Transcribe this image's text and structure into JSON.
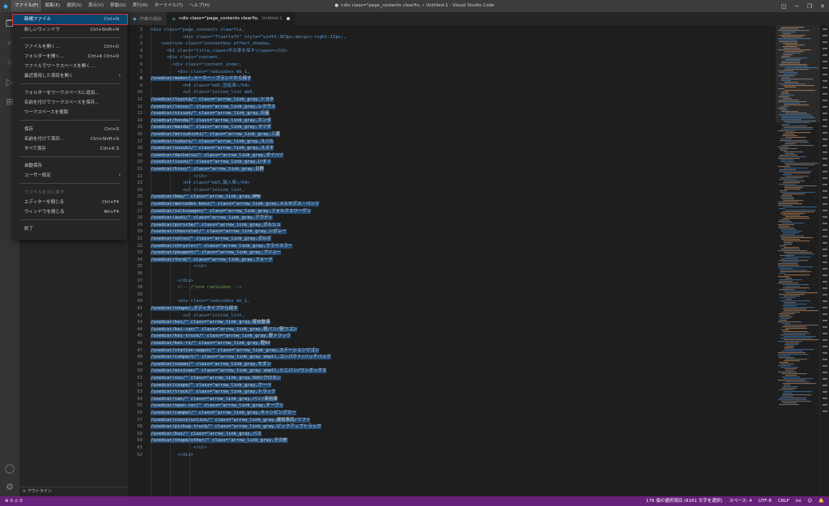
{
  "titlebar": {
    "window_title": "● <div class=\"page_contents clearfix, • Untitled-1 - Visual Studio Code",
    "menus": [
      "ファイル(F)",
      "編集(E)",
      "選択(S)",
      "表示(V)",
      "移動(G)",
      "実行(R)",
      "ターミナル(T)",
      "ヘルプ(H)"
    ]
  },
  "tabs": {
    "welcome": "作業の開始",
    "active": "<div class=\"page_contents clearfix,",
    "active_sub": "Untitled-1"
  },
  "file_menu": {
    "items": [
      {
        "label": "新規ファイル",
        "key": "Ctrl+N"
      },
      {
        "label": "新しいウィンドウ",
        "key": "Ctrl+Shift+N"
      },
      {
        "label": "ファイルを開く...",
        "key": "Ctrl+O"
      },
      {
        "label": "フォルダーを開く...",
        "key": "Ctrl+K Ctrl+O"
      },
      {
        "label": "ファイルでワークスペースを開く...",
        "key": ""
      },
      {
        "label": "最近使用した項目を開く",
        "key": ""
      },
      {
        "label": "フォルダーをワークスペースに追加...",
        "key": ""
      },
      {
        "label": "名前を付けてワークスペースを保存...",
        "key": ""
      },
      {
        "label": "ワークスペースを複製",
        "key": ""
      },
      {
        "label": "保存",
        "key": "Ctrl+S"
      },
      {
        "label": "名前を付けて保存...",
        "key": "Ctrl+Shift+S"
      },
      {
        "label": "すべて保存",
        "key": "Ctrl+K S"
      },
      {
        "label": "自動保存",
        "key": ""
      },
      {
        "label": "ユーザー設定",
        "key": ""
      },
      {
        "label": "ファイルを元に戻す",
        "key": ""
      },
      {
        "label": "エディターを閉じる",
        "key": "Ctrl+F4"
      },
      {
        "label": "ウィンドウを閉じる",
        "key": "Alt+F4"
      },
      {
        "label": "終了",
        "key": ""
      }
    ]
  },
  "sidebar": {
    "outline_label": "> アウトライン"
  },
  "editor": {
    "lines": [
      {
        "n": "1",
        "t": "<div class=\"page_contents clearfix,"
      },
      {
        "n": "2",
        "t": "            <div class=\"floatleft\" style=\"width:363px;margin-right:15px;,"
      },
      {
        "n": "3",
        "t": "    <section class=\"contentbox effect_shadow,"
      },
      {
        "n": "4",
        "t": "      <h2 class=\"title,<span>中古車を探す</span></h2>"
      },
      {
        "n": "5",
        "t": "      <div class=\"content,"
      },
      {
        "n": "6",
        "t": "        <div class=\"content_inner,"
      },
      {
        "n": "7",
        "t": "          <div class=\"radiusbox mb_1,"
      },
      {
        "n": "8",
        "t": "/usedcar/maker/,メーカー・ブランドから探す"
      },
      {
        "n": "9",
        "t": "            <h4 class=\"mb5,国産車</h4>"
      },
      {
        "n": "10",
        "t": "            <ul class=\"inline_list mb5,"
      },
      {
        "n": "11",
        "t": "/usedcar/toyota/\" class=\"arrow_link_gray,トヨタ"
      },
      {
        "n": "12",
        "t": "/usedcar/lexus/\" class=\"arrow_link_gray,レクサス"
      },
      {
        "n": "13",
        "t": "/usedcar/nissan/\" class=\"arrow_link_gray,日産"
      },
      {
        "n": "14",
        "t": "/usedcar/honda/\" class=\"arrow_link_gray,ホンダ"
      },
      {
        "n": "15",
        "t": "/usedcar/mazda/\" class=\"arrow_link_gray,マツダ"
      },
      {
        "n": "16",
        "t": "/usedcar/mitsubishi/\" class=\"arrow_link_gray,三菱"
      },
      {
        "n": "17",
        "t": "/usedcar/subaru/\" class=\"arrow_link_gray,スバル"
      },
      {
        "n": "18",
        "t": "/usedcar/suzuki/\" class=\"arrow_link_gray,スズキ"
      },
      {
        "n": "19",
        "t": "/usedcar/daihatsu/\" class=\"arrow_link_gray,ダイハツ"
      },
      {
        "n": "20",
        "t": "/usedcar/isuzu/\" class=\"arrow_link_gray,いすゞ"
      },
      {
        "n": "21",
        "t": "/usedcar/hino/\" class=\"arrow_link_gray,日野"
      },
      {
        "n": "22",
        "t": "                </ul>"
      },
      {
        "n": "23",
        "t": "            <h4 class=\"mb5,輸入車</h4>"
      },
      {
        "n": "24",
        "t": "            <ul class=\"inline_list,"
      },
      {
        "n": "25",
        "t": "/usedcar/bmw/\" class=\"arrow_link_gray,BMW"
      },
      {
        "n": "26",
        "t": "/usedcar/mercedes-benz/\" class=\"arrow_link_gray,メルセデス・ベンツ"
      },
      {
        "n": "27",
        "t": "/usedcar/volkswagen/\" class=\"arrow_link_gray,フォルクスワーゲン"
      },
      {
        "n": "28",
        "t": "/usedcar/audi/\" class=\"arrow_link_gray,アウディ"
      },
      {
        "n": "29",
        "t": "/usedcar/porsche/\" class=\"arrow_link_gray,ポルシェ"
      },
      {
        "n": "30",
        "t": "/usedcar/chevrolet/\" class=\"arrow_link_gray,シボレー"
      },
      {
        "n": "31",
        "t": "/usedcar/volvo/\" class=\"arrow_link_gray,ボルボ"
      },
      {
        "n": "32",
        "t": "/usedcar/chrysler/\" class=\"arrow_link_gray,クライスラー"
      },
      {
        "n": "33",
        "t": "/usedcar/peugeot/\" class=\"arrow_link_gray,プジョー"
      },
      {
        "n": "34",
        "t": "/usedcar/ford/\" class=\"arrow_link_gray,フォード"
      },
      {
        "n": "35",
        "t": "                </ul>"
      },
      {
        "n": "36",
        "t": ""
      },
      {
        "n": "37",
        "t": "          </div>"
      },
      {
        "n": "38",
        "t": "          <!-- //end radiusbox -->"
      },
      {
        "n": "39",
        "t": ""
      },
      {
        "n": "40",
        "t": "          <div class=\"radiusbox mb_1,"
      },
      {
        "n": "41",
        "t": "/usedcar/shape/,ボディタイプから探す"
      },
      {
        "n": "42",
        "t": "            <ul class=\"inline_list,"
      },
      {
        "n": "43",
        "t": "/usedcar/kei/\" class=\"arrow_link_gray,軽自動車"
      },
      {
        "n": "44",
        "t": "/usedcar/kei-van/\" class=\"arrow_link_gray,軽バン/軽ワゴン"
      },
      {
        "n": "45",
        "t": "/usedcar/kei-truck/\" class=\"arrow_link_gray,軽トラック"
      },
      {
        "n": "46",
        "t": "/usedcar/kei-rv/\" class=\"arrow_link_gray,軽RV"
      },
      {
        "n": "47",
        "t": "/usedcar/station-wagon/\" class=\"arrow_link_gray,ステーションワゴン"
      },
      {
        "n": "48",
        "t": "/usedcar/compact/\" class=\"arrow_link_gray small,コンパクト/ハッチバック"
      },
      {
        "n": "49",
        "t": "/usedcar/sedan/\" class=\"arrow_link_gray,セダン"
      },
      {
        "n": "50",
        "t": "/usedcar/minivan/\" class=\"arrow_link_gray small,ミニバン/ワンボックス"
      },
      {
        "n": "51",
        "t": "/usedcar/suv/\" class=\"arrow_link_gray,SUV/クロカン"
      },
      {
        "n": "52",
        "t": "/usedcar/coupe/\" class=\"arrow_link_gray,クーペ"
      },
      {
        "n": "53",
        "t": "/usedcar/truck/\" class=\"arrow_link_gray,トラック"
      },
      {
        "n": "54",
        "t": "/usedcar/van/\" class=\"arrow_link_gray,バン/商用車"
      },
      {
        "n": "55",
        "t": "/usedcar/open-car/\" class=\"arrow_link_gray,オープン"
      },
      {
        "n": "56",
        "t": "/usedcar/camper/\" class=\"arrow_link_gray,キャンピングカー"
      },
      {
        "n": "57",
        "t": "/usedcar/construction/\" class=\"arrow_link_gray,建設車両/リフト"
      },
      {
        "n": "58",
        "t": "/usedcar/pickup-truck/\" class=\"arrow_link_gray,ピックアップトラック"
      },
      {
        "n": "59",
        "t": "/usedcar/bus/\" class=\"arrow_link_gray,バス"
      },
      {
        "n": "60",
        "t": "/usedcar/shape/other/\" class=\"arrow_link_gray,その他"
      },
      {
        "n": "61",
        "t": "                </ul>"
      },
      {
        "n": "62",
        "t": "          </div>"
      }
    ]
  },
  "statusbar": {
    "left": "⊗ 0 ⚠ 0",
    "right": [
      "176 個の選択項目 (8161 文字を選択)",
      "スペース: 4",
      "UTF-8",
      "CRLF",
      "ini",
      "☺",
      "🔔"
    ]
  },
  "colors": {
    "statusbar": "#68217a",
    "menu_highlight": "#094771",
    "highlight_outline": "#e0322b",
    "selection": "#264f78"
  }
}
